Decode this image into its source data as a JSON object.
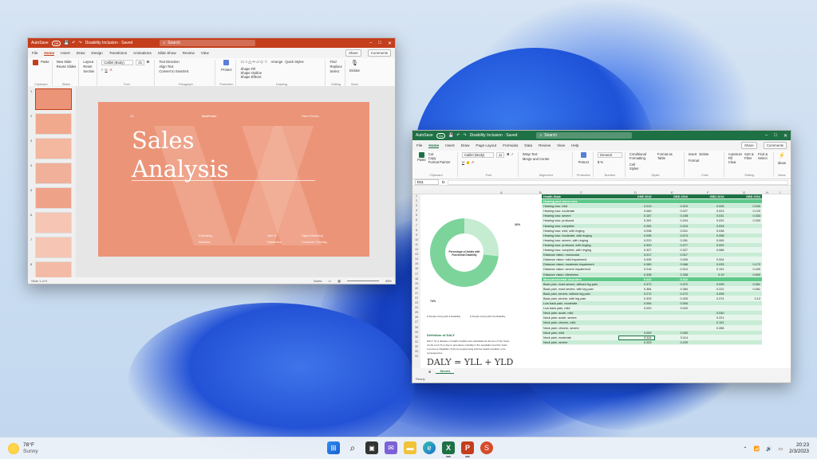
{
  "colors": {
    "ppt_accent": "#c43e1c",
    "excel_accent": "#1e7145",
    "slide_bg": "#eb9478",
    "table_header": "#1e7145",
    "table_section": "#5fc98a",
    "table_row_odd": "#c8ecd5",
    "table_row_even": "#e7f6ec"
  },
  "ppt": {
    "autosave": "AutoSave",
    "autosave_state": "Off",
    "title": "Disability Inclusion · Saved",
    "search": "Search",
    "menu": [
      "File",
      "Home",
      "Insert",
      "Draw",
      "Design",
      "Transitions",
      "Animations",
      "Slide Show",
      "Review",
      "View"
    ],
    "share": "Share",
    "comments": "Comments",
    "ribbon": {
      "paste": "Paste",
      "new_slide": "New Slide",
      "reuse_slides": "Reuse Slides",
      "layout": "Layout",
      "reset": "Reset",
      "section": "Section",
      "font_name": "Calibri (Body)",
      "font_size": "21",
      "text_direction": "Text Direction",
      "align_text": "Align Text",
      "convert_smartart": "Convert to SmartArt",
      "protect": "Protect",
      "arrange": "Arrange",
      "quick_styles": "Quick Styles",
      "shape_fill": "Shape Fill",
      "shape_outline": "Shape Outline",
      "shape_effects": "Shape Effects",
      "find": "Find",
      "replace": "Replace",
      "select": "Select",
      "dictate": "Dictate",
      "groups": [
        "Clipboard",
        "Slides",
        "Font",
        "Paragraph",
        "Protection",
        "Drawing",
        "Editing",
        "Voice"
      ]
    },
    "slide": {
      "title_line1": "Sales",
      "title_line2": "Analysis",
      "top_left": "VA",
      "top_center": "NeoPrinter",
      "top_right": "Sales Review",
      "footer": [
        "Evaluating",
        "Sale of",
        "Digital Marketing",
        "Numbers",
        "Distribution",
        "Consumer Trending"
      ]
    },
    "status_slide": "Slide 1 of 9",
    "status_notes": "Notes",
    "status_zoom": "98%"
  },
  "excel": {
    "autosave": "AutoSave",
    "autosave_state": "On",
    "title": "Disability Inclusion · Saved",
    "search": "Search",
    "menu": [
      "File",
      "Home",
      "Insert",
      "Draw",
      "Page Layout",
      "Formulas",
      "Data",
      "Review",
      "View",
      "Help"
    ],
    "share": "Share",
    "comments": "Comments",
    "ribbon": {
      "paste": "Paste",
      "cut": "Cut",
      "copy": "Copy",
      "format_painter": "Format Painter",
      "font_name": "Calibri (Body)",
      "font_size": "11",
      "wrap_text": "Wrap Text",
      "merge_center": "Merge and Center",
      "number_format": "General",
      "protect": "Protect",
      "conditional_formatting": "Conditional Formatting",
      "format_as_table": "Format as Table",
      "cell_styles": "Cell Styles",
      "insert": "Insert",
      "delete": "Delete",
      "format": "Format",
      "autosum": "AutoSum",
      "fill": "Fill",
      "clear": "Clear",
      "sort_filter": "Sort & Filter",
      "find_select": "Find & Select",
      "ideas": "Ideas",
      "groups": [
        "Clipboard",
        "Font",
        "Alignment",
        "Protection",
        "Number",
        "Styles",
        "Cells",
        "Editing",
        "Ideas"
      ]
    },
    "name_box": "D11",
    "columns": [
      "A",
      "B",
      "C",
      "D",
      "E",
      "F",
      "G",
      "H",
      "I"
    ],
    "rows": [
      "1",
      "2",
      "3",
      "4",
      "5",
      "6",
      "7",
      "8",
      "9",
      "10",
      "11",
      "12",
      "13",
      "14",
      "15",
      "16",
      "17",
      "18",
      "19",
      "20",
      "21",
      "22",
      "23",
      "24",
      "25",
      "26",
      "27",
      "28",
      "29",
      "30",
      "31",
      "32",
      "33",
      "34"
    ],
    "chart_data": {
      "type": "pie",
      "categories": [
        "People Living with a Disability",
        "People Living with No Disability"
      ],
      "values": [
        26,
        74
      ],
      "title": "Percentage of Adults with Functional Disability",
      "labels": [
        "26%",
        "74%"
      ],
      "legend": "bottom"
    },
    "chart_legend": [
      "People Living with a Disability",
      "People Living with No Disability"
    ],
    "dalys": {
      "heading": "Definition of DALY",
      "body_1": "DALY: for a disease or health condition are calculated as the sum of the Years",
      "body_2": "of Life Lost (YLL) due to premature mortality in the population and the Years",
      "body_3": "Lost due to Disability (YLD) for people living with the health condition or its",
      "body_4": "consequences.",
      "formula": "DALY = YLL + YLD"
    },
    "table": {
      "headers": [
        "Health State",
        "GHE 2016",
        "GBD 2016",
        "GBD 2010",
        "GBD 2004"
      ],
      "rows": [
        {
          "label": "Hearing and vision loss",
          "type": "sec",
          "v": [
            "",
            "",
            "",
            ""
          ]
        },
        {
          "label": "Hearing loss: mild",
          "v": [
            "0.010",
            "0.010",
            "0.005",
            "0.040"
          ]
        },
        {
          "label": "Hearing loss: moderate",
          "v": [
            "0.060",
            "0.027",
            "0.023",
            "0.120"
          ]
        },
        {
          "label": "Hearing loss: severe",
          "v": [
            "0.167",
            "0.158",
            "0.031",
            "0.333"
          ]
        },
        {
          "label": "Hearing loss: profound",
          "v": [
            "0.261",
            "0.204",
            "0.032",
            "0.333"
          ]
        },
        {
          "label": "Hearing loss: complete",
          "v": [
            "0.281",
            "0.215",
            "0.033",
            ""
          ]
        },
        {
          "label": "Hearing loss: mild, with ringing",
          "v": [
            "0.038",
            "0.021",
            "0.038",
            ""
          ]
        },
        {
          "label": "Hearing loss: moderate, with ringing",
          "v": [
            "0.095",
            "0.074",
            "0.058",
            ""
          ]
        },
        {
          "label": "Hearing loss: severe, with ringing",
          "v": [
            "0.220",
            "0.261",
            "0.065",
            ""
          ]
        },
        {
          "label": "Hearing loss: profound, with ringing",
          "v": [
            "0.300",
            "0.277",
            "0.092",
            ""
          ]
        },
        {
          "label": "Hearing loss: complete, with ringing",
          "v": [
            "0.327",
            "0.327",
            "0.088",
            ""
          ]
        },
        {
          "label": "Distance vision: monocular",
          "v": [
            "0.017",
            "0.017",
            "",
            ""
          ]
        },
        {
          "label": "Distance vision: mild impairment",
          "v": [
            "0.005",
            "0.005",
            "0.004",
            ""
          ]
        },
        {
          "label": "Distance vision: moderate impairment",
          "v": [
            "0.080",
            "0.066",
            "0.033",
            "0.170"
          ]
        },
        {
          "label": "Distance vision: severe impairment",
          "v": [
            "0.216",
            "0.214",
            "0.191",
            "0.430"
          ]
        },
        {
          "label": "Distance vision: blindness",
          "v": [
            "0.338",
            "0.338",
            "0.19",
            "0.600"
          ]
        },
        {
          "label": "Musculoskeletal disorders",
          "type": "sec",
          "v": [
            "0.422",
            "0.422",
            "",
            ""
          ]
        },
        {
          "label": "Back pain, most severe, without leg pain",
          "v": [
            "0.372",
            "0.372",
            "0.095",
            "0.061"
          ]
        },
        {
          "label": "Back pain, most severe, with leg pain",
          "v": [
            "0.384",
            "0.384",
            "0.222",
            "0.061"
          ]
        },
        {
          "label": "Back pain, severe, without leg pain",
          "v": [
            "0.272",
            "0.272",
            "0.095",
            ""
          ]
        },
        {
          "label": "Back pain, severe, with leg pain",
          "v": [
            "0.325",
            "0.325",
            "0.374",
            "0.12"
          ]
        },
        {
          "label": "Low back pain, moderate",
          "v": [
            "0.054",
            "0.054",
            "",
            ""
          ]
        },
        {
          "label": "Low back pain, mild",
          "v": [
            "0.020",
            "0.020",
            "",
            ""
          ]
        },
        {
          "label": "Neck pain: acute, mild",
          "v": [
            "",
            "",
            "0.040",
            ""
          ]
        },
        {
          "label": "Neck pain: acute, severe",
          "v": [
            "",
            "",
            "0.221",
            ""
          ]
        },
        {
          "label": "Neck pain: chronic, mild",
          "v": [
            "",
            "",
            "0.101",
            ""
          ]
        },
        {
          "label": "Neck pain: chronic, severe",
          "v": [
            "",
            "",
            "0.286",
            ""
          ]
        },
        {
          "label": "Neck pain, mild",
          "v": [
            "0.053",
            "0.053",
            "",
            ""
          ]
        },
        {
          "label": "Neck pain, moderate",
          "v": [
            "0.114",
            "0.114",
            "",
            ""
          ]
        },
        {
          "label": "Neck pain, severe",
          "v": [
            "0.229",
            "0.229",
            "",
            ""
          ]
        }
      ]
    },
    "sheet_tab": "Sheet1",
    "status": "Ready"
  },
  "taskbar": {
    "temperature": "78°F",
    "condition": "Sunny",
    "time": "20:23",
    "date": "2/3/2023",
    "apps": [
      "windows-start",
      "search",
      "file-explorer",
      "chat",
      "folder",
      "edge",
      "excel",
      "powerpoint",
      "store"
    ]
  }
}
